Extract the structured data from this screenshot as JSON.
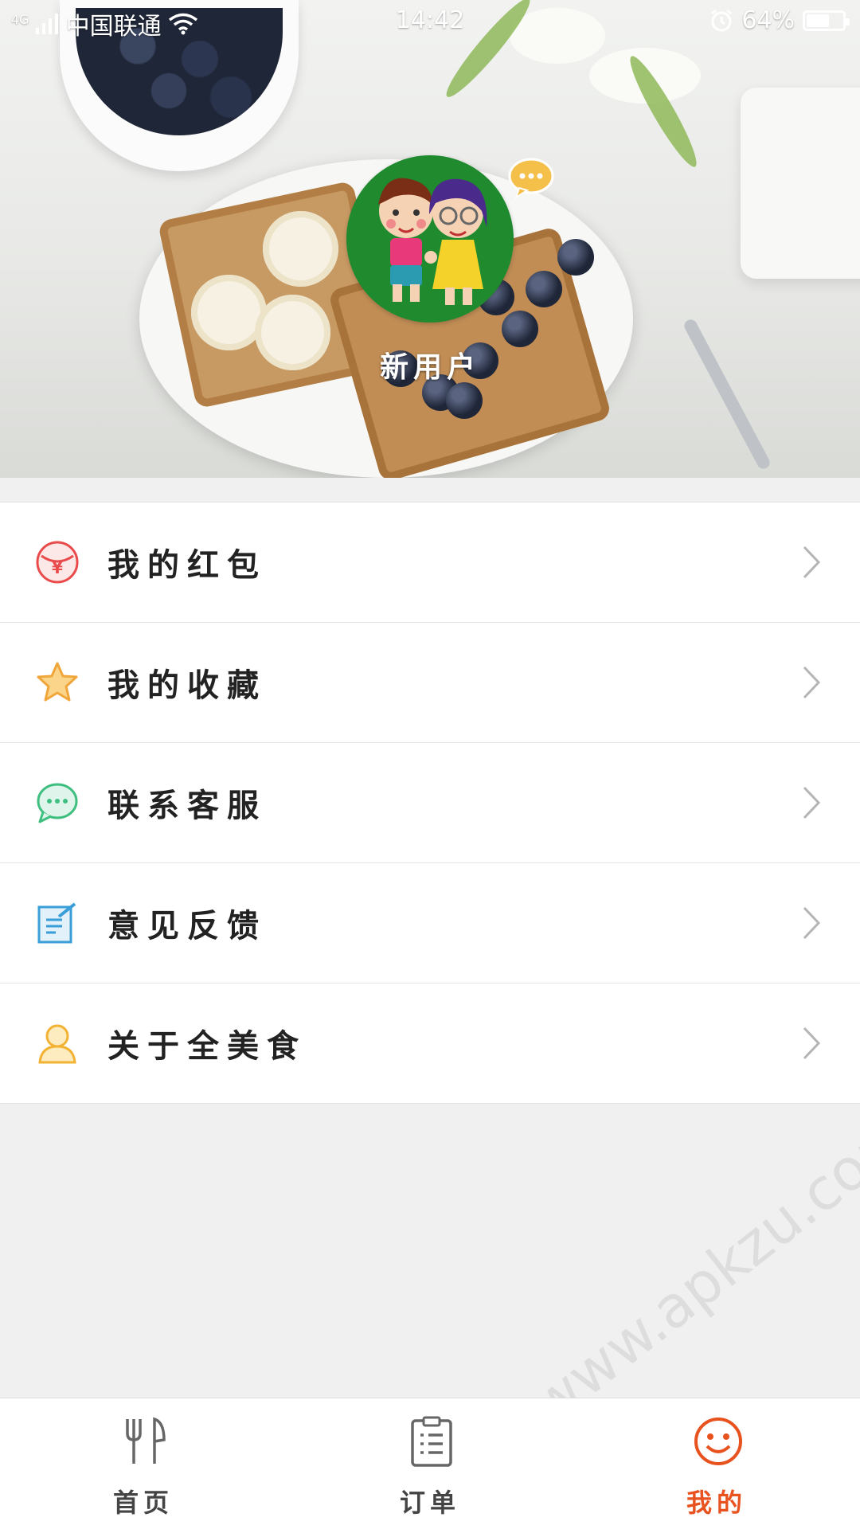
{
  "status_bar": {
    "network": "4G",
    "carrier": "中国联通",
    "time": "14:42",
    "battery_text": "64%",
    "battery_level": 0.64
  },
  "profile": {
    "username": "新用户"
  },
  "menu": {
    "items": [
      {
        "label": "我的红包",
        "icon": "red-packet-icon",
        "color": "#e94b4b"
      },
      {
        "label": "我的收藏",
        "icon": "star-icon",
        "color": "#f0a63a"
      },
      {
        "label": "联系客服",
        "icon": "chat-icon",
        "color": "#3fbf7f"
      },
      {
        "label": "意见反馈",
        "icon": "feedback-icon",
        "color": "#3a9fd8"
      },
      {
        "label": "关于全美食",
        "icon": "person-icon",
        "color": "#f2b233"
      }
    ]
  },
  "tabs": [
    {
      "label": "首页",
      "icon": "fork-knife-icon",
      "active": false
    },
    {
      "label": "订单",
      "icon": "clipboard-icon",
      "active": false
    },
    {
      "label": "我的",
      "icon": "smiley-icon",
      "active": true
    }
  ],
  "watermark": "www.apkzu.com",
  "colors": {
    "accent": "#e8521f",
    "background": "#f0f0f0"
  }
}
